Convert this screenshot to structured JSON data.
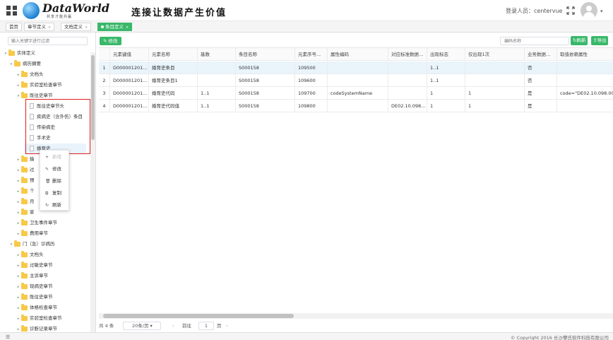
{
  "header": {
    "logo_text": "DataWorld",
    "logo_sub": "共享才能共赢",
    "slogan": "连接让数据产生价值",
    "user_label": "登录人员：centervue"
  },
  "tabs": [
    {
      "label": "首页"
    },
    {
      "label": "章节定义"
    },
    {
      "label": "文档定义"
    },
    {
      "label": "条目定义"
    }
  ],
  "sidebar": {
    "filter_placeholder": "输入关键字进行过滤",
    "nodes": [
      {
        "label": "实体定义",
        "type": "folder",
        "level": 0,
        "arrow": "▾"
      },
      {
        "label": "病历摘要",
        "type": "folder",
        "level": 1,
        "arrow": "▾"
      },
      {
        "label": "文档头",
        "type": "folder",
        "level": 2,
        "arrow": "▸"
      },
      {
        "label": "实验室检查章节",
        "type": "folder",
        "level": 2,
        "arrow": "▸"
      },
      {
        "label": "既往史章节",
        "type": "folder",
        "level": 2,
        "arrow": "▾"
      },
      {
        "label": "既往史章节头",
        "type": "doc",
        "level": 3,
        "arrow": ""
      },
      {
        "label": "疾病史（含外伤）条目",
        "type": "doc",
        "level": 3,
        "arrow": ""
      },
      {
        "label": "传染病史",
        "type": "doc",
        "level": 3,
        "arrow": ""
      },
      {
        "label": "手术史",
        "type": "doc",
        "level": 3,
        "arrow": ""
      },
      {
        "label": "婚育史",
        "type": "doc",
        "level": 3,
        "arrow": "",
        "selected": true
      },
      {
        "label": "输",
        "type": "folder",
        "level": 2,
        "arrow": "▸"
      },
      {
        "label": "过",
        "type": "folder",
        "level": 2,
        "arrow": "▸"
      },
      {
        "label": "预",
        "type": "folder",
        "level": 2,
        "arrow": "▸"
      },
      {
        "label": "个",
        "type": "folder",
        "level": 2,
        "arrow": "▸"
      },
      {
        "label": "月",
        "type": "folder",
        "level": 2,
        "arrow": "▸"
      },
      {
        "label": "家",
        "type": "folder",
        "level": 2,
        "arrow": "▸"
      },
      {
        "label": "卫生事件章节",
        "type": "folder",
        "level": 2,
        "arrow": "▸"
      },
      {
        "label": "费用章节",
        "type": "folder",
        "level": 2,
        "arrow": "▸"
      },
      {
        "label": "门（急）诊病历",
        "type": "folder",
        "level": 1,
        "arrow": "▾"
      },
      {
        "label": "文档头",
        "type": "folder",
        "level": 2,
        "arrow": "▸"
      },
      {
        "label": "过敏史章节",
        "type": "folder",
        "level": 2,
        "arrow": "▸"
      },
      {
        "label": "主诉章节",
        "type": "folder",
        "level": 2,
        "arrow": "▸"
      },
      {
        "label": "现病史章节",
        "type": "folder",
        "level": 2,
        "arrow": "▸"
      },
      {
        "label": "既往史章节",
        "type": "folder",
        "level": 2,
        "arrow": "▸"
      },
      {
        "label": "体格检查章节",
        "type": "folder",
        "level": 2,
        "arrow": "▸"
      },
      {
        "label": "实验室检查章节",
        "type": "folder",
        "level": 2,
        "arrow": "▸"
      },
      {
        "label": "诊断记录章节",
        "type": "folder",
        "level": 2,
        "arrow": "▸"
      }
    ]
  },
  "context_menu": {
    "items": [
      {
        "label": "新增",
        "icon": "+"
      },
      {
        "label": "修改",
        "icon": "✎"
      },
      {
        "label": "删除",
        "icon": "🗑"
      },
      {
        "label": "复制",
        "icon": "⧉"
      },
      {
        "label": "刷新",
        "icon": "↻"
      }
    ]
  },
  "toolbar": {
    "edit_label": "修改",
    "search_placeholder": "编码名称",
    "refresh_label": "刷新",
    "export_label": "导出"
  },
  "grid": {
    "columns": [
      "",
      "元素键值",
      "元素名称",
      "基数",
      "条目名称",
      "元素序号...",
      "属性编码",
      "对应标准数据...",
      "出现标志",
      "仅出现1次",
      "业务数据...",
      "取值依赖属性"
    ],
    "rows": [
      [
        "1",
        "D000001201...",
        "婚育史条目",
        "",
        "S000158",
        "109500",
        "",
        "",
        "1..1",
        "",
        "否",
        ""
      ],
      [
        "2",
        "D000001201...",
        "婚育史条目1",
        "",
        "S000158",
        "109600",
        "",
        "",
        "1..1",
        "",
        "否",
        ""
      ],
      [
        "3",
        "D000001201...",
        "婚育史代码",
        "1..1",
        "S000158",
        "109700",
        "codeSystemName",
        "",
        "1",
        "1",
        "是",
        "code=\"DE02.10.098.00\""
      ],
      [
        "4",
        "D000001201...",
        "婚育史代码值",
        "1..1",
        "S000158",
        "109800",
        "",
        "DE02.10.098...",
        "1",
        "1",
        "是",
        ""
      ]
    ]
  },
  "pager": {
    "total": "共 4 条",
    "page_size": "20条/页",
    "goto": "前往",
    "page": "1",
    "page_unit": "页"
  },
  "footer": {
    "copyright": "© Copyright 2016 长沙攀氏软件科技有限公司"
  }
}
